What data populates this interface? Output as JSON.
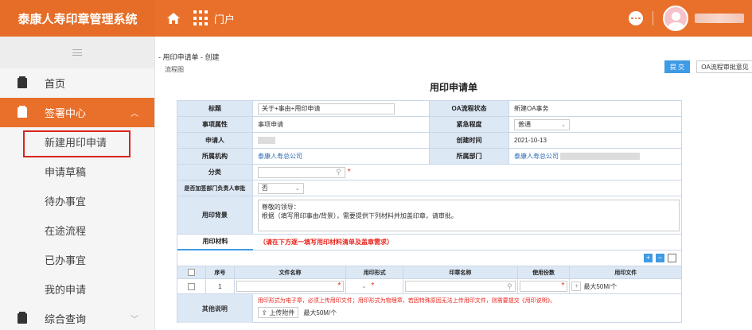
{
  "app": {
    "title": "泰康人寿印章管理系统",
    "portal_label": "门户"
  },
  "sidebar": {
    "items": [
      {
        "label": "首页"
      },
      {
        "label": "签署中心"
      },
      {
        "label": "综合查询"
      }
    ],
    "sub_items": [
      {
        "label": "新建用印申请"
      },
      {
        "label": "申请草稿"
      },
      {
        "label": "待办事宜"
      },
      {
        "label": "在途流程"
      },
      {
        "label": "已办事宜"
      },
      {
        "label": "我的申请"
      }
    ]
  },
  "main": {
    "breadcrumb": "- 用印申请单 - 创建",
    "flow_chart_link": "流程图",
    "submit_label": "提 交",
    "oa_button_label": "OA流程审批意见",
    "form_title": "用印申请单"
  },
  "form": {
    "title_label": "标题",
    "title_value": "关于+事由+用印申请",
    "oa_status_label": "OA流程状态",
    "oa_status_value": "新建OA事务",
    "attr_label": "事项属性",
    "attr_value": "事项申请",
    "urgency_label": "紧急程度",
    "urgency_value": "普通",
    "applicant_label": "申请人",
    "created_label": "创建时间",
    "created_value": "2021-10-13",
    "org_label": "所属机构",
    "org_value": "泰康人寿总公司",
    "dept_label": "所属部门",
    "dept_value": "泰康人寿总公司",
    "category_label": "分类",
    "approval_label": "是否加签部门负责人审批",
    "approval_value": "否",
    "background_label": "用印背景",
    "background_value": "尊敬的领导：\n      根据（填写用印事由/背景），需要提供下列材料并加盖印章，请审批。",
    "materials_tab": "用印材料",
    "materials_tip": "（请在下方逐一填写用印材料清单及盖章需求）"
  },
  "table": {
    "headers": [
      "序号",
      "文件名称",
      "用印形式",
      "印章名称",
      "使用份数",
      "用印文件"
    ],
    "rows": [
      {
        "index": "1",
        "max_size": "最大50M/个"
      }
    ]
  },
  "notes": {
    "label": "其他说明",
    "text": "用印形式为电子章，必须上传用印文件；用印形式为物理章，若因特殊原因无法上传用印文件，则需要提交《用印说明》。",
    "upload_label": "上传附件",
    "max_size": "最大50M/个"
  },
  "colors": {
    "brand": "#e8702a",
    "accent_blue": "#3e9be5",
    "required_red": "#e8251c",
    "label_bg": "#dde8f5"
  },
  "icons": [
    "home-icon",
    "grid-icon",
    "more-icon",
    "avatar",
    "menu-toggle-icon",
    "doc-icon",
    "chevron-up-icon",
    "chevron-down-icon",
    "search-icon",
    "plus-icon",
    "minus-icon",
    "copy-icon",
    "upload-icon"
  ]
}
